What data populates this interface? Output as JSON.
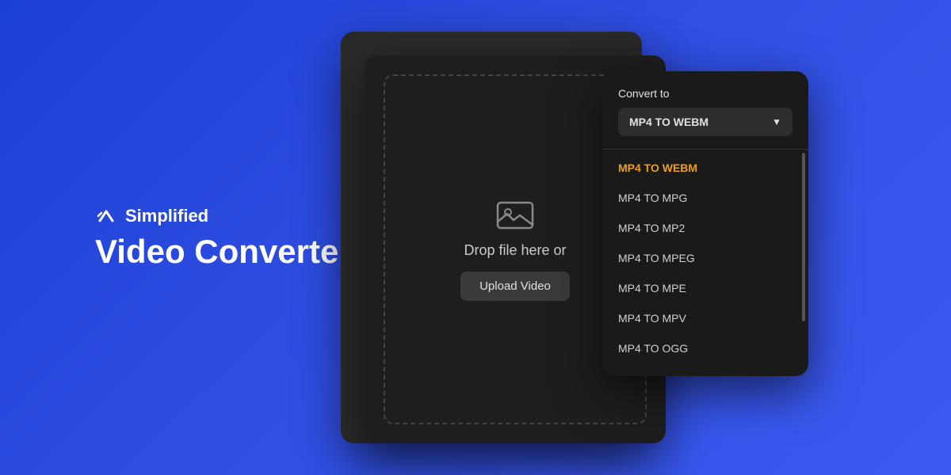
{
  "branding": {
    "logo_text": "Simplified",
    "app_title": "Video Converter"
  },
  "converter": {
    "drop_text": "Drop file here or",
    "upload_button": "Upload Video"
  },
  "dropdown": {
    "label": "Convert to",
    "selected": "MP4 TO WEBM",
    "items": [
      {
        "label": "MP4 TO WEBM",
        "active": true
      },
      {
        "label": "MP4 TO MPG",
        "active": false
      },
      {
        "label": "MP4 TO MP2",
        "active": false
      },
      {
        "label": "MP4 TO MPEG",
        "active": false
      },
      {
        "label": "MP4 TO MPE",
        "active": false
      },
      {
        "label": "MP4 TO MPV",
        "active": false
      },
      {
        "label": "MP4 TO OGG",
        "active": false
      }
    ]
  }
}
